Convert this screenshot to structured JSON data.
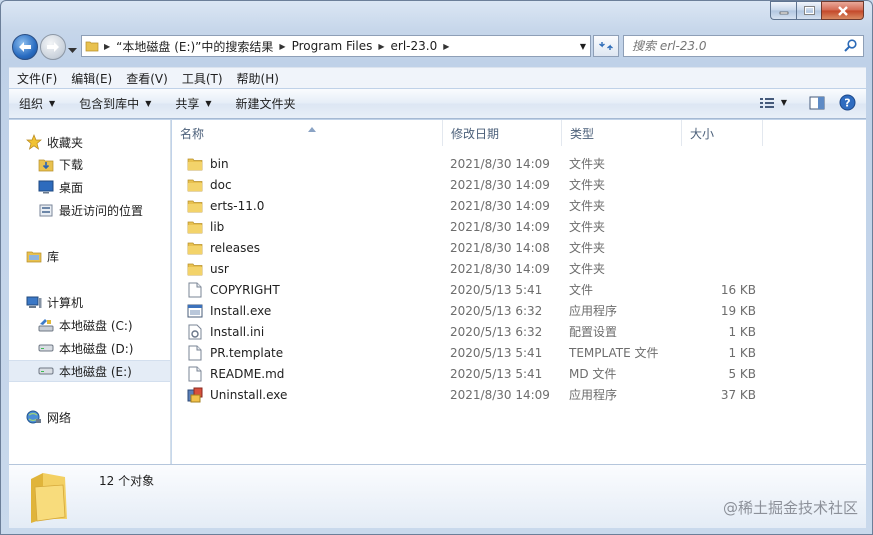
{
  "address": {
    "segments": [
      "“本地磁盘 (E:)”中的搜索结果",
      "Program Files",
      "erl-23.0"
    ],
    "search_placeholder": "搜索 erl-23.0"
  },
  "menu": [
    "文件(F)",
    "编辑(E)",
    "查看(V)",
    "工具(T)",
    "帮助(H)"
  ],
  "commands": {
    "organize": "组织",
    "include_library": "包含到库中",
    "share": "共享",
    "new_folder": "新建文件夹"
  },
  "nav": {
    "favorites": "收藏夹",
    "downloads": "下载",
    "desktop": "桌面",
    "recent": "最近访问的位置",
    "libraries": "库",
    "computer": "计算机",
    "drive_c": "本地磁盘 (C:)",
    "drive_d": "本地磁盘 (D:)",
    "drive_e": "本地磁盘 (E:)",
    "network": "网络"
  },
  "columns": {
    "name": "名称",
    "date": "修改日期",
    "type": "类型",
    "size": "大小"
  },
  "files": [
    {
      "name": "bin",
      "date": "2021/8/30 14:09",
      "type": "文件夹",
      "size": "",
      "icon": "folder-icon"
    },
    {
      "name": "doc",
      "date": "2021/8/30 14:09",
      "type": "文件夹",
      "size": "",
      "icon": "folder-icon"
    },
    {
      "name": "erts-11.0",
      "date": "2021/8/30 14:09",
      "type": "文件夹",
      "size": "",
      "icon": "folder-icon"
    },
    {
      "name": "lib",
      "date": "2021/8/30 14:09",
      "type": "文件夹",
      "size": "",
      "icon": "folder-icon"
    },
    {
      "name": "releases",
      "date": "2021/8/30 14:08",
      "type": "文件夹",
      "size": "",
      "icon": "folder-icon"
    },
    {
      "name": "usr",
      "date": "2021/8/30 14:09",
      "type": "文件夹",
      "size": "",
      "icon": "folder-icon"
    },
    {
      "name": "COPYRIGHT",
      "date": "2020/5/13 5:41",
      "type": "文件",
      "size": "16 KB",
      "icon": "file-icon"
    },
    {
      "name": "Install.exe",
      "date": "2020/5/13 6:32",
      "type": "应用程序",
      "size": "19 KB",
      "icon": "exe-icon"
    },
    {
      "name": "Install.ini",
      "date": "2020/5/13 6:32",
      "type": "配置设置",
      "size": "1 KB",
      "icon": "ini-icon"
    },
    {
      "name": "PR.template",
      "date": "2020/5/13 5:41",
      "type": "TEMPLATE 文件",
      "size": "1 KB",
      "icon": "file-icon"
    },
    {
      "name": "README.md",
      "date": "2020/5/13 5:41",
      "type": "MD 文件",
      "size": "5 KB",
      "icon": "file-icon"
    },
    {
      "name": "Uninstall.exe",
      "date": "2021/8/30 14:09",
      "type": "应用程序",
      "size": "37 KB",
      "icon": "uninstall-icon"
    }
  ],
  "details": {
    "count": "12 个对象"
  },
  "watermark": "@稀土掘金技术社区"
}
